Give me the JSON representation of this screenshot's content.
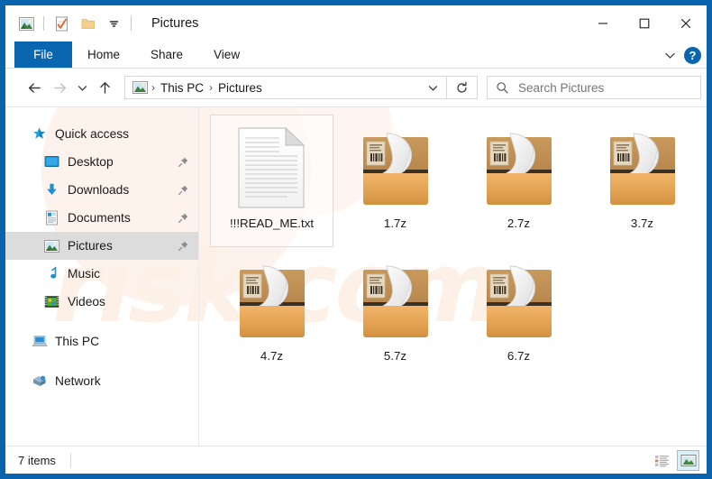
{
  "window": {
    "title": "Pictures",
    "quick_access_icons": [
      "picture-icon",
      "checkmark-document-icon",
      "folder-icon",
      "chevron-down-icon"
    ],
    "controls": {
      "minimize": "–",
      "maximize": "□",
      "close": "✕"
    },
    "frame_color": "#0a64ad"
  },
  "ribbon": {
    "tabs": [
      {
        "label": "File",
        "active": true
      },
      {
        "label": "Home",
        "active": false
      },
      {
        "label": "Share",
        "active": false
      },
      {
        "label": "View",
        "active": false
      }
    ],
    "expand_icon": "chevron-down-icon",
    "help_label": "?",
    "accent_color": "#0b66b0"
  },
  "address": {
    "back_icon": "arrow-left-icon",
    "forward_icon": "arrow-right-icon",
    "recent_icon": "chevron-down-icon",
    "up_icon": "arrow-up-icon",
    "crumb_icon": "picture-icon",
    "breadcrumb": [
      "This PC",
      "Pictures"
    ],
    "separator": "›",
    "dropdown_icon": "chevron-down-icon",
    "refresh_icon": "refresh-icon"
  },
  "search": {
    "icon": "search-icon",
    "placeholder": "Search Pictures",
    "value": ""
  },
  "sidebar": {
    "items": [
      {
        "label": "Quick access",
        "icon": "star-icon",
        "indent": false,
        "pinned": false,
        "selected": false,
        "gap_before": false
      },
      {
        "label": "Desktop",
        "icon": "desktop-icon",
        "indent": true,
        "pinned": true,
        "selected": false,
        "gap_before": false
      },
      {
        "label": "Downloads",
        "icon": "download-icon",
        "indent": true,
        "pinned": true,
        "selected": false,
        "gap_before": false
      },
      {
        "label": "Documents",
        "icon": "document-icon",
        "indent": true,
        "pinned": true,
        "selected": false,
        "gap_before": false
      },
      {
        "label": "Pictures",
        "icon": "picture-icon",
        "indent": true,
        "pinned": true,
        "selected": true,
        "gap_before": false
      },
      {
        "label": "Music",
        "icon": "music-icon",
        "indent": true,
        "pinned": false,
        "selected": false,
        "gap_before": false
      },
      {
        "label": "Videos",
        "icon": "video-icon",
        "indent": true,
        "pinned": false,
        "selected": false,
        "gap_before": false
      },
      {
        "label": "This PC",
        "icon": "computer-icon",
        "indent": false,
        "pinned": false,
        "selected": false,
        "gap_before": true
      },
      {
        "label": "Network",
        "icon": "network-icon",
        "indent": false,
        "pinned": false,
        "selected": false,
        "gap_before": true
      }
    ],
    "selected_bg": "#dcdcdc"
  },
  "files": [
    {
      "name": "!!!READ_ME.txt",
      "icon": "text-document-icon",
      "selected": true
    },
    {
      "name": "1.7z",
      "icon": "sevenzip-archive-icon",
      "selected": false
    },
    {
      "name": "2.7z",
      "icon": "sevenzip-archive-icon",
      "selected": false
    },
    {
      "name": "3.7z",
      "icon": "sevenzip-archive-icon",
      "selected": false
    },
    {
      "name": "4.7z",
      "icon": "sevenzip-archive-icon",
      "selected": false
    },
    {
      "name": "5.7z",
      "icon": "sevenzip-archive-icon",
      "selected": false
    },
    {
      "name": "6.7z",
      "icon": "sevenzip-archive-icon",
      "selected": false
    }
  ],
  "status": {
    "item_count_text": "7 items",
    "views": [
      {
        "name": "details-view",
        "active": false
      },
      {
        "name": "large-icons-view",
        "active": true
      }
    ]
  },
  "watermark": {
    "text": "risk.com",
    "color": "#fdf0e6"
  }
}
